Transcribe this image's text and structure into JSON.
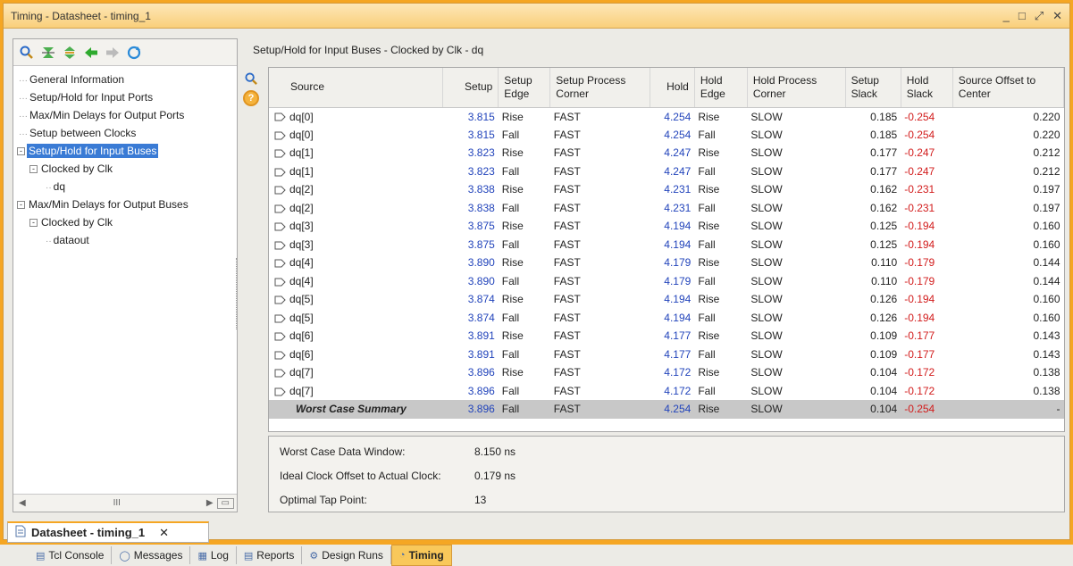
{
  "window": {
    "title": "Timing - Datasheet - timing_1",
    "controls": {
      "minimize": "_",
      "maximize": "□",
      "restore": "⤢",
      "close": "✕"
    }
  },
  "left_panel": {
    "toolbar_icons": [
      "search-icon",
      "collapse-all-icon",
      "expand-all-icon",
      "back-arrow-icon",
      "forward-arrow-icon",
      "refresh-icon"
    ],
    "tree": [
      {
        "label": "General Information",
        "level": 0
      },
      {
        "label": "Setup/Hold for Input Ports",
        "level": 0
      },
      {
        "label": "Max/Min Delays for Output Ports",
        "level": 0
      },
      {
        "label": "Setup between Clocks",
        "level": 0
      },
      {
        "label": "Setup/Hold for Input Buses",
        "level": 0,
        "selected": true,
        "expander": "-"
      },
      {
        "label": "Clocked by Clk",
        "level": 1,
        "expander": "-"
      },
      {
        "label": "dq",
        "level": 2
      },
      {
        "label": "Max/Min Delays for Output Buses",
        "level": 0,
        "expander": "-"
      },
      {
        "label": "Clocked by Clk",
        "level": 1,
        "expander": "-"
      },
      {
        "label": "dataout",
        "level": 2
      }
    ],
    "scroll_thumb": "III"
  },
  "panel_title": "Setup/Hold for Input Buses - Clocked by Clk - dq",
  "table": {
    "headers": [
      "Source",
      "Setup",
      "Setup Edge",
      "Setup Process Corner",
      "Hold",
      "Hold Edge",
      "Hold Process Corner",
      "Setup Slack",
      "Hold Slack",
      "Source Offset to Center"
    ],
    "rows": [
      [
        "dq[0]",
        "3.815",
        "Rise",
        "FAST",
        "4.254",
        "Rise",
        "SLOW",
        "0.185",
        "-0.254",
        "0.220"
      ],
      [
        "dq[0]",
        "3.815",
        "Fall",
        "FAST",
        "4.254",
        "Fall",
        "SLOW",
        "0.185",
        "-0.254",
        "0.220"
      ],
      [
        "dq[1]",
        "3.823",
        "Rise",
        "FAST",
        "4.247",
        "Rise",
        "SLOW",
        "0.177",
        "-0.247",
        "0.212"
      ],
      [
        "dq[1]",
        "3.823",
        "Fall",
        "FAST",
        "4.247",
        "Fall",
        "SLOW",
        "0.177",
        "-0.247",
        "0.212"
      ],
      [
        "dq[2]",
        "3.838",
        "Rise",
        "FAST",
        "4.231",
        "Rise",
        "SLOW",
        "0.162",
        "-0.231",
        "0.197"
      ],
      [
        "dq[2]",
        "3.838",
        "Fall",
        "FAST",
        "4.231",
        "Fall",
        "SLOW",
        "0.162",
        "-0.231",
        "0.197"
      ],
      [
        "dq[3]",
        "3.875",
        "Rise",
        "FAST",
        "4.194",
        "Rise",
        "SLOW",
        "0.125",
        "-0.194",
        "0.160"
      ],
      [
        "dq[3]",
        "3.875",
        "Fall",
        "FAST",
        "4.194",
        "Fall",
        "SLOW",
        "0.125",
        "-0.194",
        "0.160"
      ],
      [
        "dq[4]",
        "3.890",
        "Rise",
        "FAST",
        "4.179",
        "Rise",
        "SLOW",
        "0.110",
        "-0.179",
        "0.144"
      ],
      [
        "dq[4]",
        "3.890",
        "Fall",
        "FAST",
        "4.179",
        "Fall",
        "SLOW",
        "0.110",
        "-0.179",
        "0.144"
      ],
      [
        "dq[5]",
        "3.874",
        "Rise",
        "FAST",
        "4.194",
        "Rise",
        "SLOW",
        "0.126",
        "-0.194",
        "0.160"
      ],
      [
        "dq[5]",
        "3.874",
        "Fall",
        "FAST",
        "4.194",
        "Fall",
        "SLOW",
        "0.126",
        "-0.194",
        "0.160"
      ],
      [
        "dq[6]",
        "3.891",
        "Rise",
        "FAST",
        "4.177",
        "Rise",
        "SLOW",
        "0.109",
        "-0.177",
        "0.143"
      ],
      [
        "dq[6]",
        "3.891",
        "Fall",
        "FAST",
        "4.177",
        "Fall",
        "SLOW",
        "0.109",
        "-0.177",
        "0.143"
      ],
      [
        "dq[7]",
        "3.896",
        "Rise",
        "FAST",
        "4.172",
        "Rise",
        "SLOW",
        "0.104",
        "-0.172",
        "0.138"
      ],
      [
        "dq[7]",
        "3.896",
        "Fall",
        "FAST",
        "4.172",
        "Fall",
        "SLOW",
        "0.104",
        "-0.172",
        "0.138"
      ]
    ],
    "summary": [
      "Worst Case Summary",
      "3.896",
      "Fall",
      "FAST",
      "4.254",
      "Rise",
      "SLOW",
      "0.104",
      "-0.254",
      "-"
    ]
  },
  "metrics": [
    {
      "label": "Worst Case Data Window:",
      "value": "8.150 ns"
    },
    {
      "label": "Ideal Clock Offset to Actual Clock:",
      "value": "0.179 ns"
    },
    {
      "label": "Optimal Tap Point:",
      "value": "13"
    }
  ],
  "doc_tab": {
    "label": "Datasheet - timing_1",
    "close": "✕"
  },
  "bottom_tabs": [
    {
      "label": "Tcl Console",
      "icon": "console-icon"
    },
    {
      "label": "Messages",
      "icon": "messages-icon"
    },
    {
      "label": "Log",
      "icon": "log-icon"
    },
    {
      "label": "Reports",
      "icon": "reports-icon"
    },
    {
      "label": "Design Runs",
      "icon": "design-runs-icon"
    },
    {
      "label": "Timing",
      "icon": "timing-icon",
      "active": true
    }
  ],
  "colors": {
    "accent": "#f5a623",
    "selection": "#3a7bd5",
    "value_blue": "#2244bb",
    "negative_red": "#d21c1c"
  }
}
